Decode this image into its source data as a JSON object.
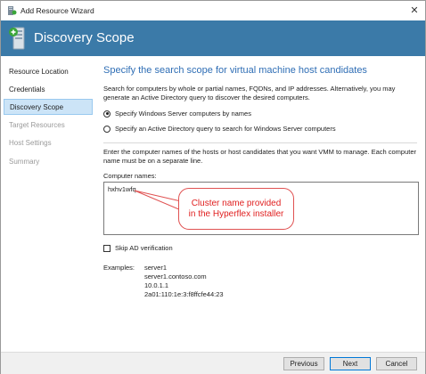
{
  "window": {
    "title": "Add Resource Wizard",
    "close_glyph": "✕"
  },
  "banner": {
    "title": "Discovery Scope",
    "icon": "server-add-icon"
  },
  "nav": {
    "items": [
      {
        "label": "Resource Location",
        "state": "normal"
      },
      {
        "label": "Credentials",
        "state": "normal"
      },
      {
        "label": "Discovery Scope",
        "state": "active"
      },
      {
        "label": "Target Resources",
        "state": "disabled"
      },
      {
        "label": "Host Settings",
        "state": "disabled"
      },
      {
        "label": "Summary",
        "state": "disabled"
      }
    ]
  },
  "content": {
    "heading": "Specify the search scope for virtual machine host candidates",
    "description": "Search for computers by whole or partial names, FQDNs, and IP addresses. Alternatively, you may generate an Active Directory query to discover the desired computers.",
    "radio_names": "Specify Windows Server computers by names",
    "radio_ad": "Specify an Active Directory query to search for Windows Server computers",
    "selected_radio": "names",
    "instructions": "Enter the computer names of the hosts or host candidates that you want VMM to manage. Each computer name must be on a separate line.",
    "computer_names_label": "Computer names:",
    "computer_names_value": "hxhv1wfq",
    "callout_line1": "Cluster name provided",
    "callout_line2": "in the Hyperflex installer",
    "skip_ad_label": "Skip AD verification",
    "skip_ad_checked": false,
    "examples_label": "Examples:",
    "examples": [
      "server1",
      "server1.contoso.com",
      "10.0.1.1",
      "2a01:110:1e:3:f8ffcfe44:23"
    ]
  },
  "footer": {
    "previous": "Previous",
    "next": "Next",
    "cancel": "Cancel"
  },
  "colors": {
    "banner": "#3b7aa8",
    "heading": "#2f6eb5",
    "callout": "#e02020",
    "nav_active": "#cce4f7"
  }
}
